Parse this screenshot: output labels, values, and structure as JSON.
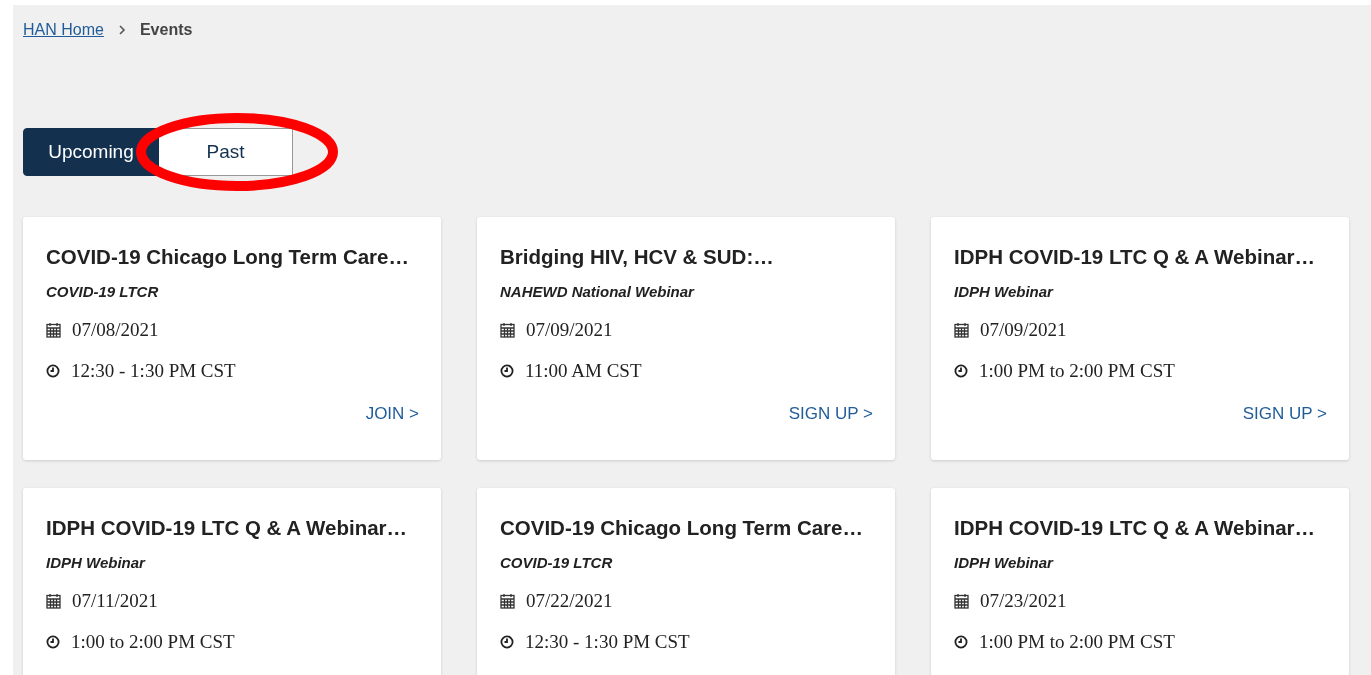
{
  "breadcrumb": [
    {
      "label": "HAN Home",
      "kind": "link"
    },
    {
      "label": "Events",
      "kind": "current"
    }
  ],
  "tabs": [
    {
      "label": "Upcoming",
      "selected": true
    },
    {
      "label": "Past",
      "selected": false
    }
  ],
  "events": [
    {
      "title": "COVID-19 Chicago Long Term Care…",
      "series": "COVID-19 LTCR",
      "date": "07/08/2021",
      "time": "12:30 - 1:30 PM CST",
      "action": "JOIN >"
    },
    {
      "title": "Bridging HIV, HCV & SUD:…",
      "series": "NAHEWD National Webinar",
      "date": "07/09/2021",
      "time": "11:00 AM CST",
      "action": "SIGN UP >"
    },
    {
      "title": "IDPH COVID-19 LTC Q & A Webinar…",
      "series": "IDPH Webinar",
      "date": "07/09/2021",
      "time": "1:00 PM to 2:00 PM CST",
      "action": "SIGN UP >"
    },
    {
      "title": "IDPH COVID-19 LTC Q & A Webinar…",
      "series": "IDPH Webinar",
      "date": "07/11/2021",
      "time": "1:00 to 2:00 PM CST"
    },
    {
      "title": "COVID-19 Chicago Long Term Care…",
      "series": "COVID-19 LTCR",
      "date": "07/22/2021",
      "time": "12:30 - 1:30 PM CST"
    },
    {
      "title": "IDPH COVID-19 LTC Q & A Webinar…",
      "series": "IDPH Webinar",
      "date": "07/23/2021",
      "time": "1:00 PM to 2:00 PM CST"
    }
  ]
}
